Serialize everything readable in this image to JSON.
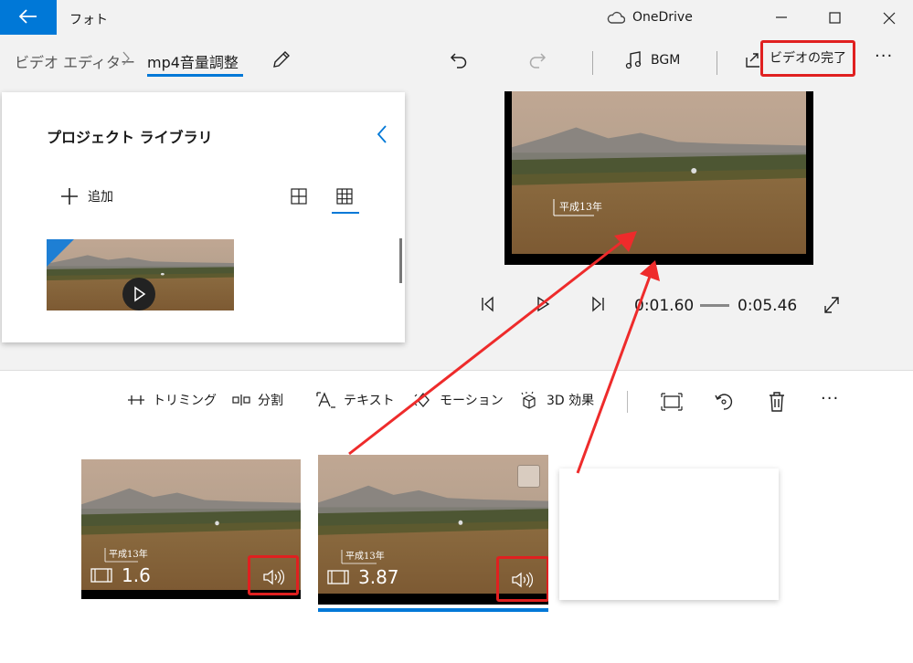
{
  "titlebar": {
    "app_title": "フォト",
    "onedrive_label": "OneDrive"
  },
  "breadcrumb": {
    "root": "ビデオ エディター",
    "current": "mp4音量調整"
  },
  "toolbar": {
    "bgm_label": "BGM",
    "finish_label": "ビデオの完了"
  },
  "library": {
    "title": "プロジェクト ライブラリ",
    "add_label": "追加"
  },
  "preview": {
    "overlay_text": "平成13年",
    "current_time": "0:01.60",
    "total_time": "0:05.46"
  },
  "storyboard": {
    "tools": [
      {
        "label": "トリミング",
        "icon": "trim-icon"
      },
      {
        "label": "分割",
        "icon": "split-icon"
      },
      {
        "label": "テキスト",
        "icon": "text-icon"
      },
      {
        "label": "モーション",
        "icon": "motion-icon"
      },
      {
        "label": "3D 効果",
        "icon": "3d-effects-icon"
      }
    ],
    "clips": [
      {
        "caption": "平成13年",
        "duration": "1.6",
        "selected": false
      },
      {
        "caption": "平成13年",
        "duration": "3.87",
        "selected": true
      }
    ]
  },
  "colors": {
    "accent": "#0078d7",
    "highlight": "#e02020"
  }
}
